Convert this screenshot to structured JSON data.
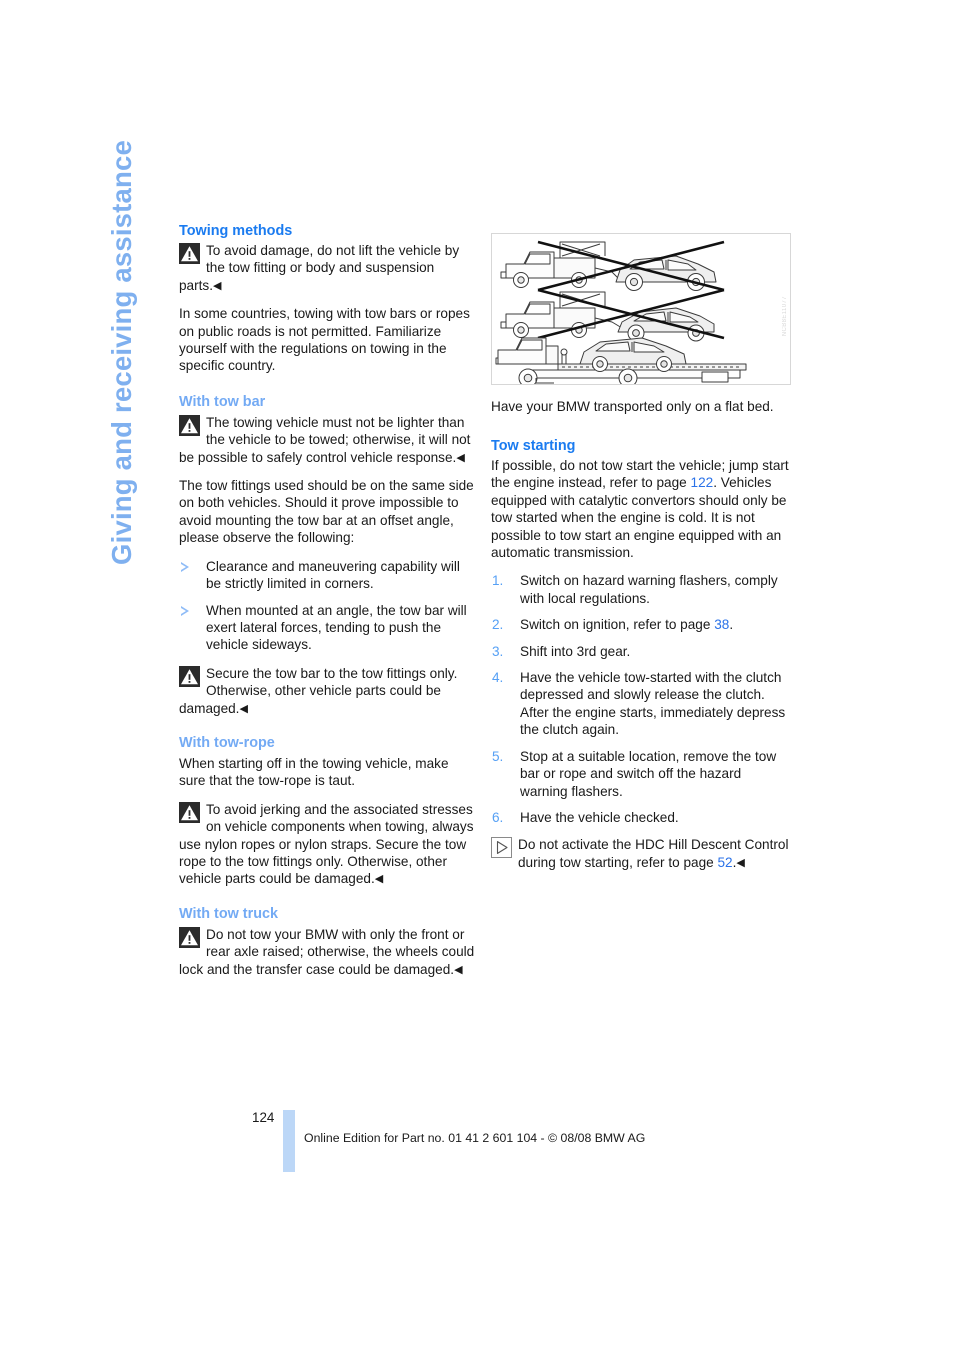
{
  "chapter": {
    "vertical_title": "Giving and receiving assistance"
  },
  "left_column": {
    "section_heading": "Towing methods",
    "warning_1": {
      "icon": "warning-triangle-icon",
      "text": "To avoid damage, do not lift the vehicle by the tow fitting or body and suspension parts.",
      "endmark": "◀"
    },
    "paragraph_1": "In some countries, towing with tow bars or ropes on public roads is not permitted. Familiarize yourself with the regulations on towing in the specific country.",
    "subheading_tow_bar": "With tow bar",
    "warning_2": {
      "icon": "warning-triangle-icon",
      "text": "The towing vehicle must not be lighter than the vehicle to be towed; otherwise, it will not be possible to safely control vehicle response.",
      "endmark": "◀"
    },
    "paragraph_2": "The tow fittings used should be on the same side on both vehicles. Should it prove impossible to avoid mounting the tow bar at an offset angle, please observe the following:",
    "bullets": [
      "Clearance and maneuvering capability will be strictly limited in corners.",
      "When mounted at an angle, the tow bar will exert lateral forces, tending to push the vehicle sideways."
    ],
    "warning_3": {
      "icon": "warning-triangle-icon",
      "text": "Secure the tow bar to the tow fittings only. Otherwise, other vehicle parts could be damaged.",
      "endmark": "◀"
    },
    "subheading_tow_rope": "With tow-rope",
    "paragraph_3": "When starting off in the towing vehicle, make sure that the tow-rope is taut.",
    "warning_4": {
      "icon": "warning-triangle-icon",
      "text": "To avoid jerking and the associated stresses on vehicle components when towing, always use nylon ropes or nylon straps. Secure the tow rope to the tow fittings only. Otherwise, other vehicle parts could be damaged.",
      "endmark": "◀"
    },
    "subheading_tow_truck": "With tow truck",
    "warning_5": {
      "icon": "warning-triangle-icon",
      "text": "Do not tow your BMW with only the front or rear axle raised; otherwise, the wheels could lock and the transfer case could be damaged.",
      "endmark": "◀"
    }
  },
  "right_column": {
    "figure": {
      "alt": "Three line drawings of a tow truck: top two show a BMW being towed with only one axle raised, both crossed out with an X; bottom shows the BMW correctly carried on a flat bed.",
      "watermark": "NCB8E11077"
    },
    "figure_caption": "Have your BMW transported only on a flat bed.",
    "section_heading": "Tow starting",
    "paragraph_1_a": "If possible, do not tow start the vehicle; jump start the engine instead, refer to page ",
    "paragraph_1_xref": "122",
    "paragraph_1_b": ". Vehicles equipped with catalytic convertors should only be tow started when the engine is cold. It is not possible to tow start an engine equipped with an automatic transmission.",
    "steps": [
      {
        "number": "1.",
        "text": "Switch on hazard warning flashers, comply with local regulations."
      },
      {
        "number": "2.",
        "text_a": "Switch on ignition, refer to page ",
        "xref": "38",
        "text_b": "."
      },
      {
        "number": "3.",
        "text": "Shift into 3rd gear."
      },
      {
        "number": "4.",
        "text": "Have the vehicle tow-started with the clutch depressed and slowly release the clutch. After the engine starts, immediately depress the clutch again."
      },
      {
        "number": "5.",
        "text": "Stop at a suitable location, remove the tow bar or rope and switch off the hazard warning flashers."
      },
      {
        "number": "6.",
        "text": "Have the vehicle checked."
      }
    ],
    "note": {
      "icon": "note-triangle-icon",
      "text_a": "Do not activate the HDC Hill Descent Control during tow starting, refer to page ",
      "xref": "52",
      "text_b": ".",
      "endmark": "◀"
    }
  },
  "footer": {
    "page_number": "124",
    "imprint": "Online Edition for Part no. 01 41 2 601 104 - © 08/08 BMW AG"
  },
  "colors": {
    "section_heading": "#1a7bf0",
    "sub_heading": "#73aaf4",
    "chapter_rail": "#7fb0ef",
    "xref": "#2b72e8",
    "folio_bar": "#bcd7f7"
  }
}
